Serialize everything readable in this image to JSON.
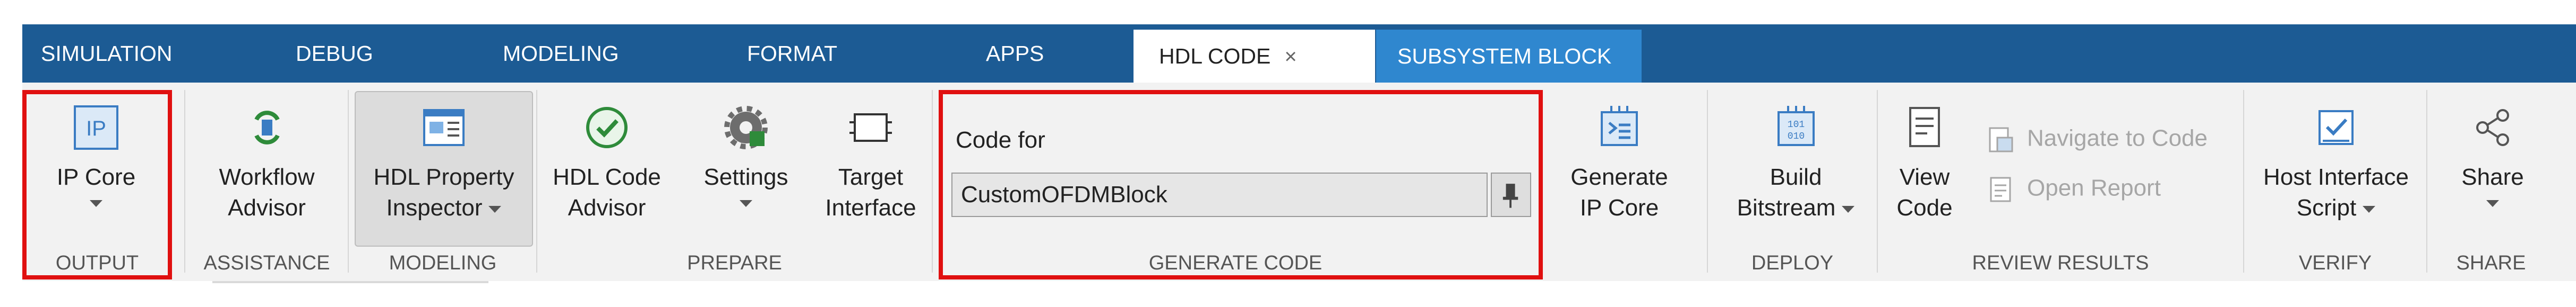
{
  "tabs": [
    {
      "label": "SIMULATION"
    },
    {
      "label": "DEBUG"
    },
    {
      "label": "MODELING"
    },
    {
      "label": "FORMAT"
    },
    {
      "label": "APPS"
    },
    {
      "label": "HDL CODE",
      "close": "×"
    },
    {
      "label": "SUBSYSTEM BLOCK"
    }
  ],
  "sections": {
    "output": "OUTPUT",
    "assistance": "ASSISTANCE",
    "modeling": "MODELING",
    "prepare": "PREPARE",
    "generate_code": "GENERATE CODE",
    "deploy": "DEPLOY",
    "review_results": "REVIEW RESULTS",
    "verify": "VERIFY",
    "share": "SHARE"
  },
  "buttons": {
    "ip_core": {
      "label": "IP Core",
      "icon": "ip-core-icon",
      "icon_text": "IP"
    },
    "workflow_advisor": {
      "line1": "Workflow",
      "line2": "Advisor"
    },
    "hdl_property_inspector": {
      "line1": "HDL Property",
      "line2": "Inspector"
    },
    "hdl_code_advisor": {
      "line1": "HDL Code",
      "line2": "Advisor"
    },
    "settings": {
      "label": "Settings"
    },
    "target_interface": {
      "line1": "Target",
      "line2": "Interface"
    },
    "generate_ip_core": {
      "line1": "Generate",
      "line2": "IP Core"
    },
    "build_bitstream": {
      "line1": "Build",
      "line2": "Bitstream"
    },
    "view_code": {
      "line1": "View",
      "line2": "Code"
    },
    "navigate_to_code": {
      "label": "Navigate to Code"
    },
    "open_report": {
      "label": "Open Report"
    },
    "host_interface_script": {
      "line1": "Host Interface",
      "line2": "Script"
    },
    "share": {
      "label": "Share"
    }
  },
  "generate_code": {
    "code_for_label": "Code for",
    "code_for_value": "CustomOFDMBlock"
  },
  "colors": {
    "tab_strip": "#1c5b94",
    "contextual_tab": "#2f87cf",
    "highlight": "#e01010",
    "ribbon_bg": "#f2f2f2"
  }
}
